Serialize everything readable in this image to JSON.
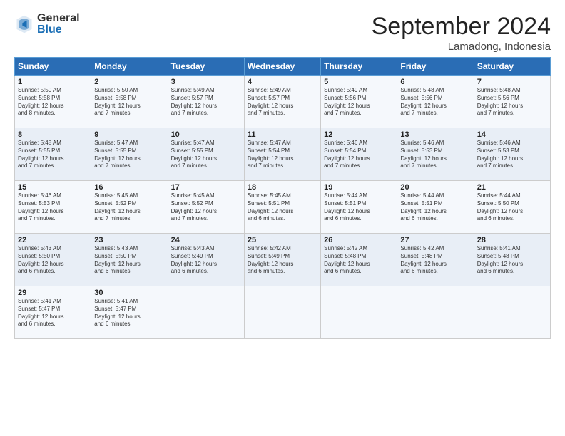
{
  "logo": {
    "general": "General",
    "blue": "Blue"
  },
  "title": "September 2024",
  "location": "Lamadong, Indonesia",
  "days_header": [
    "Sunday",
    "Monday",
    "Tuesday",
    "Wednesday",
    "Thursday",
    "Friday",
    "Saturday"
  ],
  "weeks": [
    [
      {
        "day": "1",
        "text": "Sunrise: 5:50 AM\nSunset: 5:58 PM\nDaylight: 12 hours\nand 8 minutes."
      },
      {
        "day": "2",
        "text": "Sunrise: 5:50 AM\nSunset: 5:58 PM\nDaylight: 12 hours\nand 7 minutes."
      },
      {
        "day": "3",
        "text": "Sunrise: 5:49 AM\nSunset: 5:57 PM\nDaylight: 12 hours\nand 7 minutes."
      },
      {
        "day": "4",
        "text": "Sunrise: 5:49 AM\nSunset: 5:57 PM\nDaylight: 12 hours\nand 7 minutes."
      },
      {
        "day": "5",
        "text": "Sunrise: 5:49 AM\nSunset: 5:56 PM\nDaylight: 12 hours\nand 7 minutes."
      },
      {
        "day": "6",
        "text": "Sunrise: 5:48 AM\nSunset: 5:56 PM\nDaylight: 12 hours\nand 7 minutes."
      },
      {
        "day": "7",
        "text": "Sunrise: 5:48 AM\nSunset: 5:56 PM\nDaylight: 12 hours\nand 7 minutes."
      }
    ],
    [
      {
        "day": "8",
        "text": "Sunrise: 5:48 AM\nSunset: 5:55 PM\nDaylight: 12 hours\nand 7 minutes."
      },
      {
        "day": "9",
        "text": "Sunrise: 5:47 AM\nSunset: 5:55 PM\nDaylight: 12 hours\nand 7 minutes."
      },
      {
        "day": "10",
        "text": "Sunrise: 5:47 AM\nSunset: 5:55 PM\nDaylight: 12 hours\nand 7 minutes."
      },
      {
        "day": "11",
        "text": "Sunrise: 5:47 AM\nSunset: 5:54 PM\nDaylight: 12 hours\nand 7 minutes."
      },
      {
        "day": "12",
        "text": "Sunrise: 5:46 AM\nSunset: 5:54 PM\nDaylight: 12 hours\nand 7 minutes."
      },
      {
        "day": "13",
        "text": "Sunrise: 5:46 AM\nSunset: 5:53 PM\nDaylight: 12 hours\nand 7 minutes."
      },
      {
        "day": "14",
        "text": "Sunrise: 5:46 AM\nSunset: 5:53 PM\nDaylight: 12 hours\nand 7 minutes."
      }
    ],
    [
      {
        "day": "15",
        "text": "Sunrise: 5:46 AM\nSunset: 5:53 PM\nDaylight: 12 hours\nand 7 minutes."
      },
      {
        "day": "16",
        "text": "Sunrise: 5:45 AM\nSunset: 5:52 PM\nDaylight: 12 hours\nand 7 minutes."
      },
      {
        "day": "17",
        "text": "Sunrise: 5:45 AM\nSunset: 5:52 PM\nDaylight: 12 hours\nand 7 minutes."
      },
      {
        "day": "18",
        "text": "Sunrise: 5:45 AM\nSunset: 5:51 PM\nDaylight: 12 hours\nand 6 minutes."
      },
      {
        "day": "19",
        "text": "Sunrise: 5:44 AM\nSunset: 5:51 PM\nDaylight: 12 hours\nand 6 minutes."
      },
      {
        "day": "20",
        "text": "Sunrise: 5:44 AM\nSunset: 5:51 PM\nDaylight: 12 hours\nand 6 minutes."
      },
      {
        "day": "21",
        "text": "Sunrise: 5:44 AM\nSunset: 5:50 PM\nDaylight: 12 hours\nand 6 minutes."
      }
    ],
    [
      {
        "day": "22",
        "text": "Sunrise: 5:43 AM\nSunset: 5:50 PM\nDaylight: 12 hours\nand 6 minutes."
      },
      {
        "day": "23",
        "text": "Sunrise: 5:43 AM\nSunset: 5:50 PM\nDaylight: 12 hours\nand 6 minutes."
      },
      {
        "day": "24",
        "text": "Sunrise: 5:43 AM\nSunset: 5:49 PM\nDaylight: 12 hours\nand 6 minutes."
      },
      {
        "day": "25",
        "text": "Sunrise: 5:42 AM\nSunset: 5:49 PM\nDaylight: 12 hours\nand 6 minutes."
      },
      {
        "day": "26",
        "text": "Sunrise: 5:42 AM\nSunset: 5:48 PM\nDaylight: 12 hours\nand 6 minutes."
      },
      {
        "day": "27",
        "text": "Sunrise: 5:42 AM\nSunset: 5:48 PM\nDaylight: 12 hours\nand 6 minutes."
      },
      {
        "day": "28",
        "text": "Sunrise: 5:41 AM\nSunset: 5:48 PM\nDaylight: 12 hours\nand 6 minutes."
      }
    ],
    [
      {
        "day": "29",
        "text": "Sunrise: 5:41 AM\nSunset: 5:47 PM\nDaylight: 12 hours\nand 6 minutes."
      },
      {
        "day": "30",
        "text": "Sunrise: 5:41 AM\nSunset: 5:47 PM\nDaylight: 12 hours\nand 6 minutes."
      },
      {
        "day": "",
        "text": ""
      },
      {
        "day": "",
        "text": ""
      },
      {
        "day": "",
        "text": ""
      },
      {
        "day": "",
        "text": ""
      },
      {
        "day": "",
        "text": ""
      }
    ]
  ]
}
